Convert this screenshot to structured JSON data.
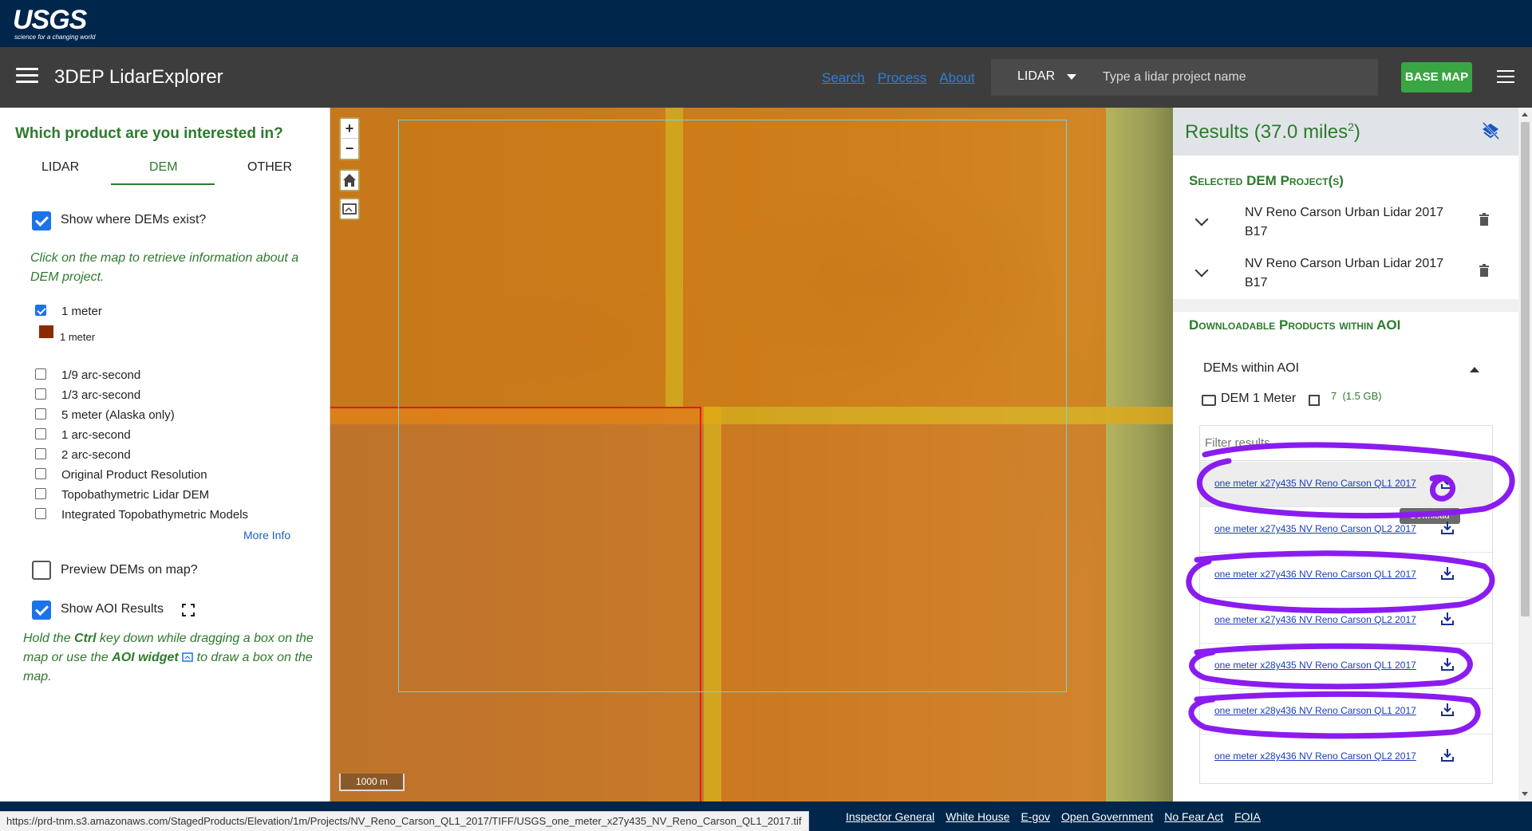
{
  "usgs": {
    "wordmark": "USGS",
    "tagline": "science for a changing world"
  },
  "header": {
    "menu_icon": "hamburger-icon",
    "title": "3DEP LidarExplorer",
    "nav": [
      "Search",
      "Process",
      "About"
    ],
    "search_type": "LIDAR",
    "search_placeholder": "Type a lidar project name",
    "basemap_label": "BASE MAP"
  },
  "left_panel": {
    "question": "Which product are you interested in?",
    "tabs": [
      "LIDAR",
      "DEM",
      "OTHER"
    ],
    "active_tab": "DEM",
    "show_dems_label": "Show where DEMs exist?",
    "show_dems_checked": true,
    "hint": "Click on the map to retrieve information about a DEM project.",
    "resolutions": [
      {
        "label": "1 meter",
        "checked": true
      },
      {
        "label": "1/9 arc-second",
        "checked": false
      },
      {
        "label": "1/3 arc-second",
        "checked": false
      },
      {
        "label": "5 meter (Alaska only)",
        "checked": false
      },
      {
        "label": "1 arc-second",
        "checked": false
      },
      {
        "label": "2 arc-second",
        "checked": false
      },
      {
        "label": "Original Product Resolution",
        "checked": false
      },
      {
        "label": "Topobathymetric Lidar DEM",
        "checked": false
      },
      {
        "label": "Integrated Topobathymetric Models",
        "checked": false
      }
    ],
    "legend_label": "1 meter",
    "legend_color": "#8b2a00",
    "more_info": "More Info",
    "preview_label": "Preview DEMs on map?",
    "preview_checked": false,
    "aoi_label": "Show AOI Results",
    "aoi_checked": true,
    "aoi_hint": {
      "p1": "Hold the ",
      "ctrl": "Ctrl",
      "p2": " key down while dragging a box on the map or use the ",
      "widget": "AOI widget",
      "p3": " to draw a box on the map."
    }
  },
  "map": {
    "zoom_in": "+",
    "zoom_out": "−",
    "scale": "1000 m"
  },
  "results": {
    "title": "Results (37.0 miles",
    "title_sup": "2",
    "title_close": ")",
    "selected_heading": "Selected DEM Project(s)",
    "projects": [
      "NV Reno Carson Urban Lidar 2017 B17",
      "NV Reno Carson Urban Lidar 2017 B17"
    ],
    "downloadable_heading": "Downloadable Products within AOI",
    "dems_within": "DEMs within AOI",
    "folder_label": "DEM 1 Meter",
    "folder_count": "7",
    "folder_size": "(1.5 GB)",
    "filter_placeholder": "Filter results",
    "files": [
      "one meter x27y435 NV Reno Carson QL1 2017",
      "one meter x27y435 NV Reno Carson QL2 2017",
      "one meter x27y436 NV Reno Carson QL1 2017",
      "one meter x27y436 NV Reno Carson QL2 2017",
      "one meter x28y435 NV Reno Carson QL1 2017",
      "one meter x28y436 NV Reno Carson QL1 2017",
      "one meter x28y436 NV Reno Carson QL2 2017"
    ],
    "tooltip": "Download"
  },
  "footer": {
    "links": [
      "Inspector General",
      "White House",
      "E-gov",
      "Open Government",
      "No Fear Act",
      "FOIA"
    ]
  },
  "status_url": "https://prd-tnm.s3.amazonaws.com/StagedProducts/Elevation/1m/Projects/NV_Reno_Carson_QL1_2017/TIFF/USGS_one_meter_x27y435_NV_Reno_Carson_QL1_2017.tif",
  "colors": {
    "accent_green": "#2d7a2d",
    "header_dark": "#3d3d3d",
    "usgs_navy": "#00264c",
    "basemap_green": "#3aa543",
    "annotation_purple": "#8a1cf0",
    "tile_orange": "#e07a1c",
    "aoi_cyan": "#5fd8e6",
    "selected_red": "#e11b1b"
  }
}
